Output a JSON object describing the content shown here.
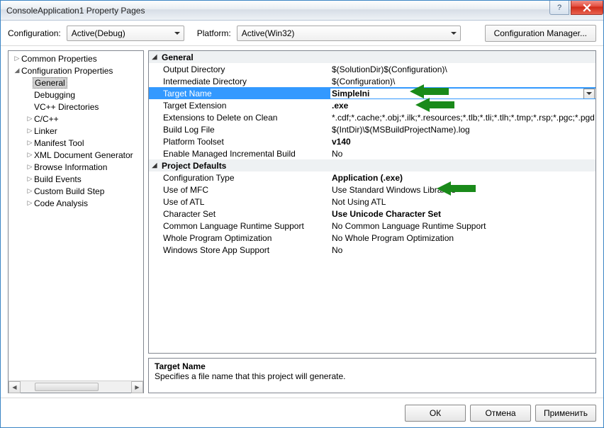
{
  "title": "ConsoleApplication1 Property Pages",
  "toolbar": {
    "config_label": "Configuration:",
    "config_value": "Active(Debug)",
    "platform_label": "Platform:",
    "platform_value": "Active(Win32)",
    "config_manager": "Configuration Manager..."
  },
  "tree": {
    "common": "Common Properties",
    "config_props": "Configuration Properties",
    "items": {
      "general": "General",
      "debugging": "Debugging",
      "vcdirs": "VC++ Directories",
      "ccpp": "C/C++",
      "linker": "Linker",
      "manifest": "Manifest Tool",
      "xmlgen": "XML Document Generator",
      "browse": "Browse Information",
      "buildev": "Build Events",
      "custom": "Custom Build Step",
      "codean": "Code Analysis"
    }
  },
  "grid": {
    "cat_general": "General",
    "cat_defaults": "Project Defaults",
    "rows": {
      "outdir": {
        "n": "Output Directory",
        "v": "$(SolutionDir)$(Configuration)\\"
      },
      "intdir": {
        "n": "Intermediate Directory",
        "v": "$(Configuration)\\"
      },
      "tname": {
        "n": "Target Name",
        "v": "SimpleIni"
      },
      "text": {
        "n": "Target Extension",
        "v": ".exe"
      },
      "extdel": {
        "n": "Extensions to Delete on Clean",
        "v": "*.cdf;*.cache;*.obj;*.ilk;*.resources;*.tlb;*.tli;*.tlh;*.tmp;*.rsp;*.pgc;*.pgd"
      },
      "blog": {
        "n": "Build Log File",
        "v": "$(IntDir)\\$(MSBuildProjectName).log"
      },
      "ptool": {
        "n": "Platform Toolset",
        "v": "v140"
      },
      "emib": {
        "n": "Enable Managed Incremental Build",
        "v": "No"
      },
      "ctype": {
        "n": "Configuration Type",
        "v": "Application (.exe)"
      },
      "mfc": {
        "n": "Use of MFC",
        "v": "Use Standard Windows Libraries"
      },
      "atl": {
        "n": "Use of ATL",
        "v": "Not Using ATL"
      },
      "cset": {
        "n": "Character Set",
        "v": "Use Unicode Character Set"
      },
      "clr": {
        "n": "Common Language Runtime Support",
        "v": "No Common Language Runtime Support"
      },
      "wpo": {
        "n": "Whole Program Optimization",
        "v": "No Whole Program Optimization"
      },
      "wsa": {
        "n": "Windows Store App Support",
        "v": "No"
      }
    }
  },
  "desc": {
    "title": "Target Name",
    "text": "Specifies a file name that this project will generate."
  },
  "buttons": {
    "ok": "ОК",
    "cancel": "Отмена",
    "apply": "Применить"
  }
}
